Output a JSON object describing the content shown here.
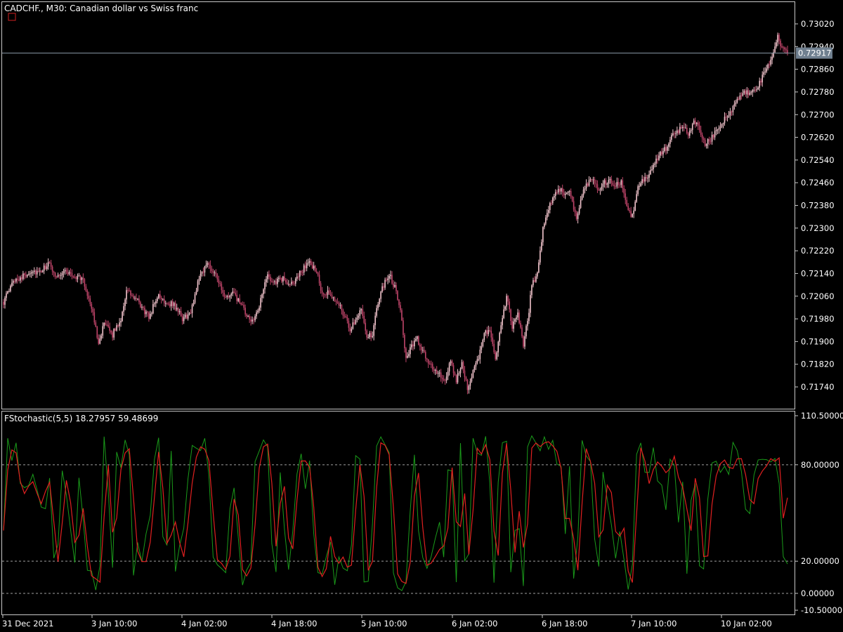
{
  "chart_title": "CADCHF., M30:  Canadian dollar vs Swiss franc",
  "indicator_title": "FStochastic(5,5) 18.27957 59.48699",
  "current_price_label": "0.72917",
  "colors": {
    "background": "#000000",
    "bull_candle": "#f2c4cc",
    "bear_candle": "#c0456a",
    "fast_line": "#1a9a1a",
    "slow_line": "#e02020",
    "price_tag_bg": "#708090",
    "grid_dashed": "#c8c8c8"
  },
  "chart_data": [
    {
      "type": "candlestick",
      "title": "CADCHF., M30:  Canadian dollar vs Swiss franc",
      "y_ticks": [
        "0.73020",
        "0.72940",
        "0.72860",
        "0.72780",
        "0.72700",
        "0.72620",
        "0.72540",
        "0.72460",
        "0.72380",
        "0.72300",
        "0.72220",
        "0.72140",
        "0.72060",
        "0.71980",
        "0.71900",
        "0.71820",
        "0.71740"
      ],
      "ylim": [
        0.7168,
        0.7306
      ],
      "current_price": 0.72917,
      "x_ticks": [
        "31 Dec 2021",
        "3 Jan 10:00",
        "4 Jan 02:00",
        "4 Jan 18:00",
        "5 Jan 10:00",
        "6 Jan 02:00",
        "6 Jan 18:00",
        "7 Jan 10:00",
        "10 Jan 02:00"
      ],
      "close_path": [
        [
          0,
          0.7204
        ],
        [
          8,
          0.7212
        ],
        [
          14,
          0.7213
        ],
        [
          20,
          0.7215
        ],
        [
          26,
          0.7214
        ],
        [
          32,
          0.72175
        ],
        [
          38,
          0.7213
        ],
        [
          44,
          0.7215
        ],
        [
          50,
          0.7213
        ],
        [
          56,
          0.72125
        ],
        [
          62,
          0.7204
        ],
        [
          68,
          0.719
        ],
        [
          72,
          0.7196
        ],
        [
          78,
          0.71925
        ],
        [
          84,
          0.7198
        ],
        [
          88,
          0.7208
        ],
        [
          96,
          0.7204
        ],
        [
          104,
          0.71985
        ],
        [
          110,
          0.7206
        ],
        [
          116,
          0.7204
        ],
        [
          122,
          0.7203
        ],
        [
          128,
          0.7198
        ],
        [
          134,
          0.72
        ],
        [
          140,
          0.7213
        ],
        [
          146,
          0.72175
        ],
        [
          152,
          0.7214
        ],
        [
          158,
          0.7205
        ],
        [
          164,
          0.7207
        ],
        [
          170,
          0.7203
        ],
        [
          176,
          0.7197
        ],
        [
          182,
          0.72
        ],
        [
          188,
          0.7213
        ],
        [
          194,
          0.7211
        ],
        [
          200,
          0.7212
        ],
        [
          206,
          0.721
        ],
        [
          212,
          0.7214
        ],
        [
          218,
          0.7218
        ],
        [
          224,
          0.7215
        ],
        [
          228,
          0.7206
        ],
        [
          232,
          0.7207
        ],
        [
          236,
          0.7205
        ],
        [
          240,
          0.72035
        ],
        [
          244,
          0.7199
        ],
        [
          248,
          0.7194
        ],
        [
          252,
          0.7198
        ],
        [
          256,
          0.7202
        ],
        [
          260,
          0.7192
        ],
        [
          264,
          0.7192
        ],
        [
          268,
          0.7204
        ],
        [
          272,
          0.721
        ],
        [
          276,
          0.7214
        ],
        [
          280,
          0.7209
        ],
        [
          284,
          0.7202
        ],
        [
          288,
          0.7184
        ],
        [
          292,
          0.7188
        ],
        [
          296,
          0.7191
        ],
        [
          300,
          0.7186
        ],
        [
          304,
          0.7183
        ],
        [
          310,
          0.7179
        ],
        [
          316,
          0.7176
        ],
        [
          320,
          0.7183
        ],
        [
          324,
          0.7176
        ],
        [
          328,
          0.7183
        ],
        [
          332,
          0.7174
        ],
        [
          336,
          0.7179
        ],
        [
          340,
          0.7184
        ],
        [
          344,
          0.7194
        ],
        [
          348,
          0.7193
        ],
        [
          352,
          0.7184
        ],
        [
          356,
          0.7195
        ],
        [
          360,
          0.7206
        ],
        [
          364,
          0.7195
        ],
        [
          368,
          0.72
        ],
        [
          372,
          0.7188
        ],
        [
          376,
          0.7201
        ],
        [
          378,
          0.721
        ],
        [
          382,
          0.7214
        ],
        [
          386,
          0.723
        ],
        [
          390,
          0.7237
        ],
        [
          394,
          0.7241
        ],
        [
          398,
          0.7244
        ],
        [
          402,
          0.7242
        ],
        [
          406,
          0.7242
        ],
        [
          410,
          0.7233
        ],
        [
          414,
          0.7242
        ],
        [
          418,
          0.7246
        ],
        [
          422,
          0.7248
        ],
        [
          426,
          0.7243
        ],
        [
          430,
          0.7246
        ],
        [
          434,
          0.7247
        ],
        [
          438,
          0.7245
        ],
        [
          442,
          0.7246
        ],
        [
          446,
          0.7238
        ],
        [
          450,
          0.7234
        ],
        [
          454,
          0.7244
        ],
        [
          458,
          0.7247
        ],
        [
          462,
          0.7249
        ],
        [
          466,
          0.7253
        ],
        [
          470,
          0.7256
        ],
        [
          474,
          0.7258
        ],
        [
          478,
          0.7262
        ],
        [
          482,
          0.7264
        ],
        [
          486,
          0.7266
        ],
        [
          490,
          0.7263
        ],
        [
          494,
          0.7268
        ],
        [
          498,
          0.7265
        ],
        [
          502,
          0.726
        ],
        [
          506,
          0.7261
        ],
        [
          510,
          0.7265
        ],
        [
          514,
          0.7267
        ],
        [
          518,
          0.727
        ],
        [
          522,
          0.7272
        ],
        [
          526,
          0.7276
        ],
        [
          530,
          0.7278
        ],
        [
          534,
          0.7277
        ],
        [
          538,
          0.7279
        ],
        [
          542,
          0.7282
        ],
        [
          546,
          0.7286
        ],
        [
          550,
          0.729
        ],
        [
          554,
          0.7298
        ],
        [
          556,
          0.7295
        ],
        [
          560,
          0.72917
        ]
      ],
      "total_bars": 562
    },
    {
      "type": "line",
      "title": "FStochastic(5,5) 18.27957 59.48699",
      "y_ticks": [
        "110.50000",
        "80.00000",
        "20.00000",
        "0.00000",
        "-10.50000"
      ],
      "ylim": [
        -10.5,
        110.5
      ],
      "levels": [
        80,
        20,
        0
      ],
      "series": [
        {
          "name": "FStochastic fast",
          "last": 18.27957
        },
        {
          "name": "FStochastic slow",
          "last": 59.48699
        }
      ]
    }
  ]
}
